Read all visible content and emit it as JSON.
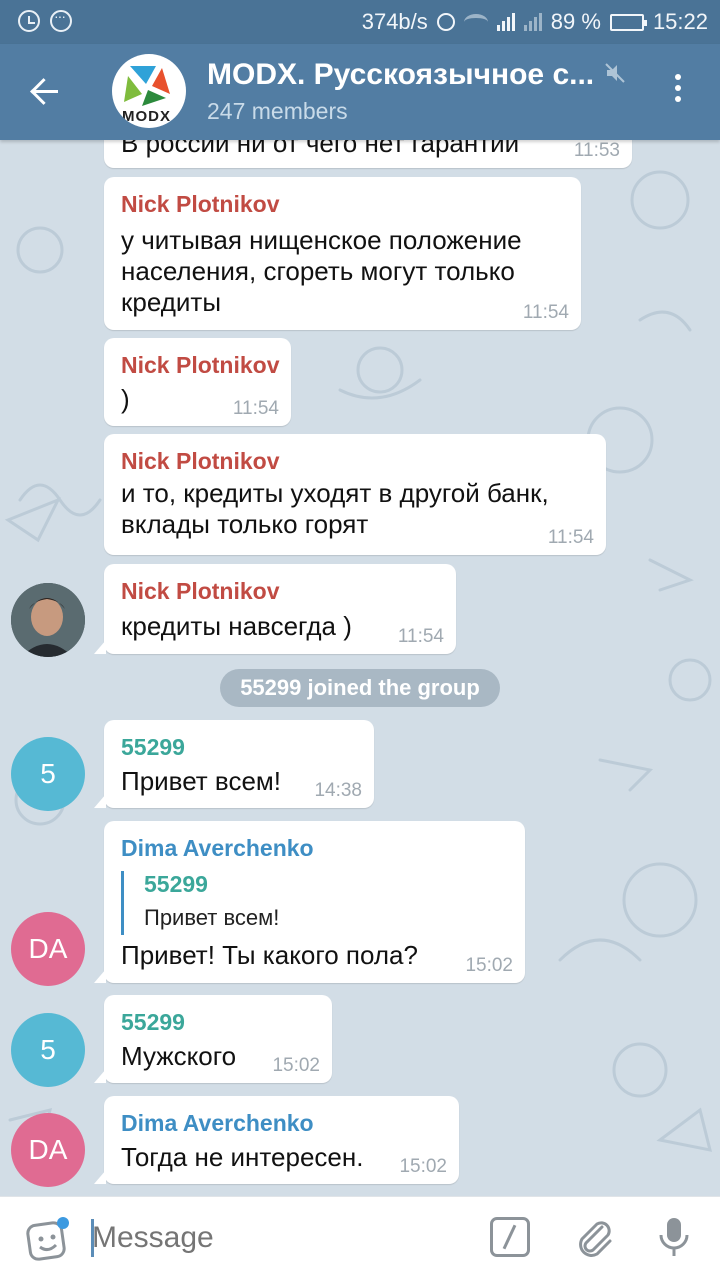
{
  "status_bar": {
    "speed": "374b/s",
    "battery": "89 %",
    "battery_level": 0.89,
    "time": "15:22"
  },
  "header": {
    "title": "MODX. Русскоязычное с...",
    "subtitle": "247 members",
    "avatar_text": "MODX",
    "muted": true
  },
  "messages": [
    {
      "sender": "",
      "lines": [
        "В россии ни от чего нет гарантии"
      ],
      "time": "11:53"
    },
    {
      "sender": "Nick Plotnikov",
      "lines": [
        "у читывая нищенское положение",
        "населения, сгореть могут только",
        "кредиты"
      ],
      "time": "11:54"
    },
    {
      "sender": "Nick Plotnikov",
      "lines": [
        ")"
      ],
      "time": "11:54"
    },
    {
      "sender": "Nick Plotnikov",
      "lines": [
        "и то, кредиты уходят в другой банк,",
        "вклады только горят"
      ],
      "time": "11:54"
    },
    {
      "sender": "Nick Plotnikov",
      "lines": [
        "кредиты навсегда )"
      ],
      "time": "11:54"
    },
    {
      "sender": "55299",
      "lines": [
        "Привет всем!"
      ],
      "time": "14:38",
      "avatar": "5"
    },
    {
      "sender": "Dima Averchenko",
      "reply_name": "55299",
      "reply_text": "Привет всем!",
      "lines": [
        "Привет! Ты какого пола?"
      ],
      "time": "15:02",
      "avatar": "DA"
    },
    {
      "sender": "55299",
      "lines": [
        "Мужского"
      ],
      "time": "15:02",
      "avatar": "5"
    },
    {
      "sender": "Dima Averchenko",
      "lines": [
        "Тогда не интересен."
      ],
      "time": "15:02",
      "avatar": "DA"
    }
  ],
  "service_message": "55299 joined the group",
  "input": {
    "placeholder": "Message"
  },
  "colors": {
    "header": "#527da3",
    "status_bar": "#4a7396",
    "chat_bg": "#d2dde6",
    "sender_red": "#c14b43",
    "sender_teal": "#3ba79a",
    "sender_blue": "#3e8ec4",
    "avatar_5": "#56b9d4",
    "avatar_da": "#e06b92"
  }
}
